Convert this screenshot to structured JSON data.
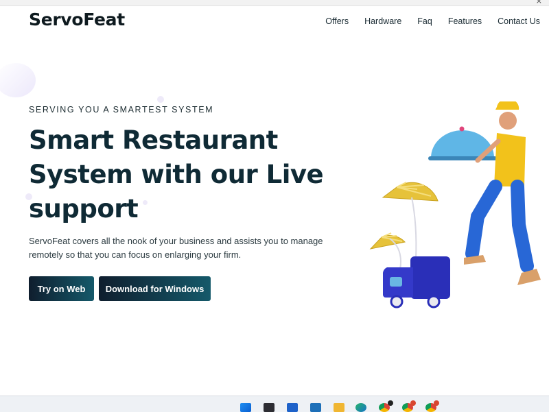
{
  "window": {
    "close_glyph": "×"
  },
  "header": {
    "logo": "ServoFeat",
    "nav": [
      "Offers",
      "Hardware",
      "Faq",
      "Features",
      "Contact Us"
    ]
  },
  "hero": {
    "eyebrow": "SERVING YOU A SMARTEST SYSTEM",
    "headline": "Smart Restaurant System with our Live support",
    "description": "ServoFeat covers all the nook of your business and assists you to manage remotely so that you can focus on enlarging your firm.",
    "primary_button": "Try on Web",
    "secondary_button": "Download for Windows"
  },
  "colors": {
    "button_start": "#0f1e2e",
    "button_end": "#15596a",
    "headline": "#0f2a35",
    "taskbar_bg": "#eef1f5"
  },
  "taskbar": {
    "icons": [
      "windows-start-icon",
      "task-view-icon",
      "store-icon",
      "mail-icon",
      "file-explorer-icon",
      "edge-icon",
      "chrome-icon",
      "chrome-profile-icon",
      "chrome-profile-2-icon"
    ]
  }
}
